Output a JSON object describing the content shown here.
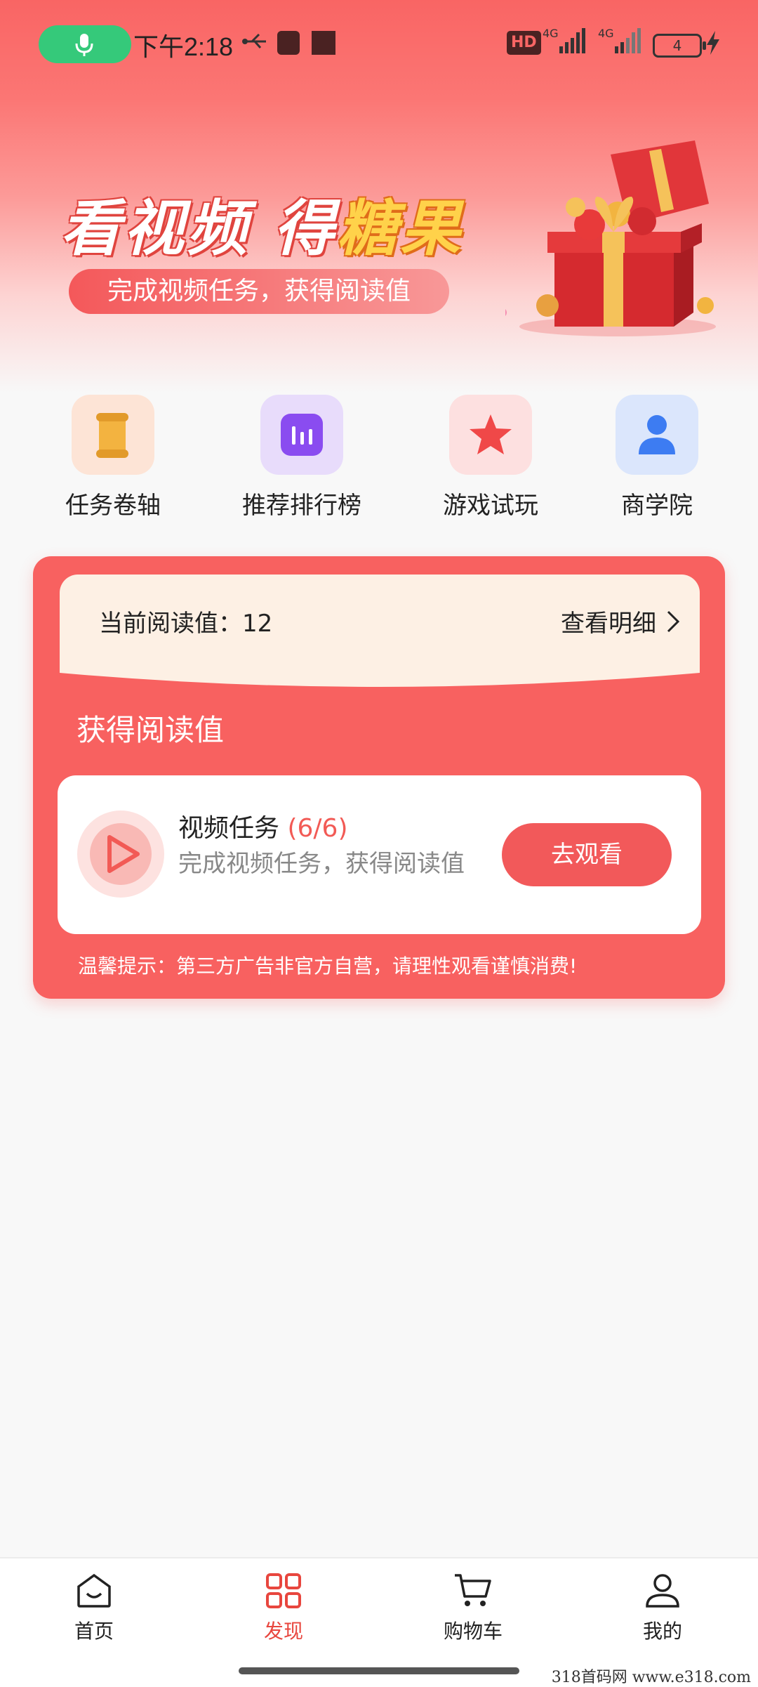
{
  "status_bar": {
    "time": "下午2:18",
    "hd_label": "HD",
    "network_1": "4G",
    "network_2": "4G",
    "battery": "4"
  },
  "banner": {
    "title_part1": "看视频 得",
    "title_highlight": "糖果",
    "subtitle": "完成视频任务，获得阅读值"
  },
  "quick_actions": [
    {
      "label": "任务卷轴",
      "icon": "scroll-icon",
      "bg": "#fde4d6"
    },
    {
      "label": "推荐排行榜",
      "icon": "bar-chart-icon",
      "bg": "#e8dcfb"
    },
    {
      "label": "游戏试玩",
      "icon": "star-icon",
      "bg": "#fde0e0"
    },
    {
      "label": "商学院",
      "icon": "user-icon",
      "bg": "#dbe6fc"
    }
  ],
  "read_card": {
    "current_label": "当前阅读值：",
    "current_value": "12",
    "detail_link": "查看明细",
    "section_title": "获得阅读值",
    "task": {
      "title": "视频任务",
      "count": "(6/6)",
      "description": "完成视频任务，获得阅读值",
      "button": "去观看"
    },
    "tip": "温馨提示：第三方广告非官方自营，请理性观看谨慎消费!"
  },
  "bottom_nav": [
    {
      "label": "首页",
      "icon": "home-icon"
    },
    {
      "label": "发现",
      "icon": "discover-icon",
      "active": true
    },
    {
      "label": "购物车",
      "icon": "cart-icon"
    },
    {
      "label": "我的",
      "icon": "profile-icon"
    }
  ],
  "watermark": "318首码网  www.e318.com",
  "colors": {
    "accent": "#f86160",
    "active_nav": "#e8463e",
    "mic_green": "#35c97a"
  }
}
